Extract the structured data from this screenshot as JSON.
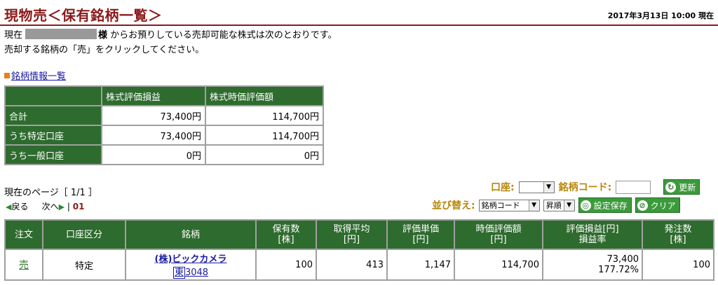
{
  "header": {
    "title": "現物売＜保有銘柄一覧＞",
    "datetime": "2017年3月13日  10:00  現在"
  },
  "intro": {
    "prefix": "現在",
    "sama": "様",
    "line1_rest": " からお預りしている売却可能な株式は次のとおりです。",
    "line2": "売却する銘柄の「売」をクリックしてください。"
  },
  "section": {
    "link_label": "銘柄情報一覧"
  },
  "summary": {
    "headers": [
      "",
      "株式評価損益",
      "株式時価評価額"
    ],
    "rows": [
      {
        "label": "合計",
        "profit": "73,400円",
        "value": "114,700円"
      },
      {
        "label": "うち特定口座",
        "profit": "73,400円",
        "value": "114,700円"
      },
      {
        "label": "うち一般口座",
        "profit": "0円",
        "value": "0円"
      }
    ]
  },
  "pagination": {
    "current_label": "現在のページ［ 1/1 ］",
    "prev": "戻る",
    "next": "次へ",
    "separator": "|",
    "page": "01"
  },
  "filters": {
    "account_label": "口座:",
    "account_value": "",
    "code_label": "銘柄コード:",
    "code_value": "",
    "refresh": "更新",
    "sort_label": "並び替え:",
    "sort_value": "銘柄コード",
    "order_value": "昇順",
    "save": "設定保存",
    "clear": "クリア"
  },
  "holdings": {
    "headers": [
      [
        "注文"
      ],
      [
        "口座区分"
      ],
      [
        "銘柄"
      ],
      [
        "保有数",
        "[株]"
      ],
      [
        "取得平均",
        "[円]"
      ],
      [
        "評価単価",
        "[円]"
      ],
      [
        "時価評価額",
        "[円]"
      ],
      [
        "評価損益[円]",
        "損益率"
      ],
      [
        "発注数",
        "[株]"
      ]
    ],
    "rows": [
      {
        "order": "売",
        "account": "特定",
        "name": "(株)ビックカメラ",
        "market": "東",
        "code": "3048",
        "quantity": "100",
        "avg_cost": "413",
        "unit_price": "1,147",
        "market_value": "114,700",
        "profit": "73,400",
        "profit_rate": "177.72%",
        "order_qty": "100"
      }
    ]
  }
}
